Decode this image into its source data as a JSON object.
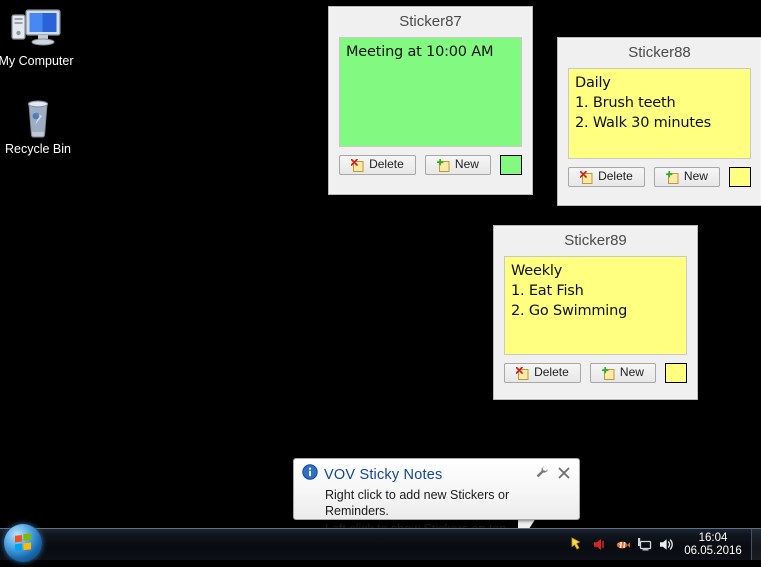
{
  "desktop": {
    "icons": [
      {
        "name": "my-computer",
        "label": "My Computer"
      },
      {
        "name": "recycle-bin",
        "label": "Recycle Bin"
      }
    ]
  },
  "stickers": [
    {
      "title": "Sticker87",
      "text": "Meeting at 10:00 AM",
      "color": "#82fa82",
      "delete_label": "Delete",
      "new_label": "New"
    },
    {
      "title": "Sticker88",
      "text": "Daily\n1. Brush teeth\n2. Walk 30 minutes",
      "color": "#ffff80",
      "delete_label": "Delete",
      "new_label": "New"
    },
    {
      "title": "Sticker89",
      "text": "Weekly\n1. Eat Fish\n2. Go Swimming",
      "color": "#ffff80",
      "delete_label": "Delete",
      "new_label": "New"
    }
  ],
  "balloon": {
    "title": "VOV  Sticky Notes",
    "line1": "Right click to add new Stickers or Reminders.",
    "line2": "Left click to show Stickers on top.",
    "info_icon": "info-icon",
    "options_icon": "wrench-icon",
    "close_icon": "close-icon",
    "title_color": "#12469b"
  },
  "taskbar": {
    "start_icon": "windows-start-orb",
    "tray_icons": [
      "sticky-notes-tray-icon",
      "volume-muted-tray-icon",
      "clownfish-tray-icon",
      "network-tray-icon",
      "speaker-tray-icon"
    ],
    "clock_time": "16:04",
    "clock_date": "06.05.2016"
  }
}
